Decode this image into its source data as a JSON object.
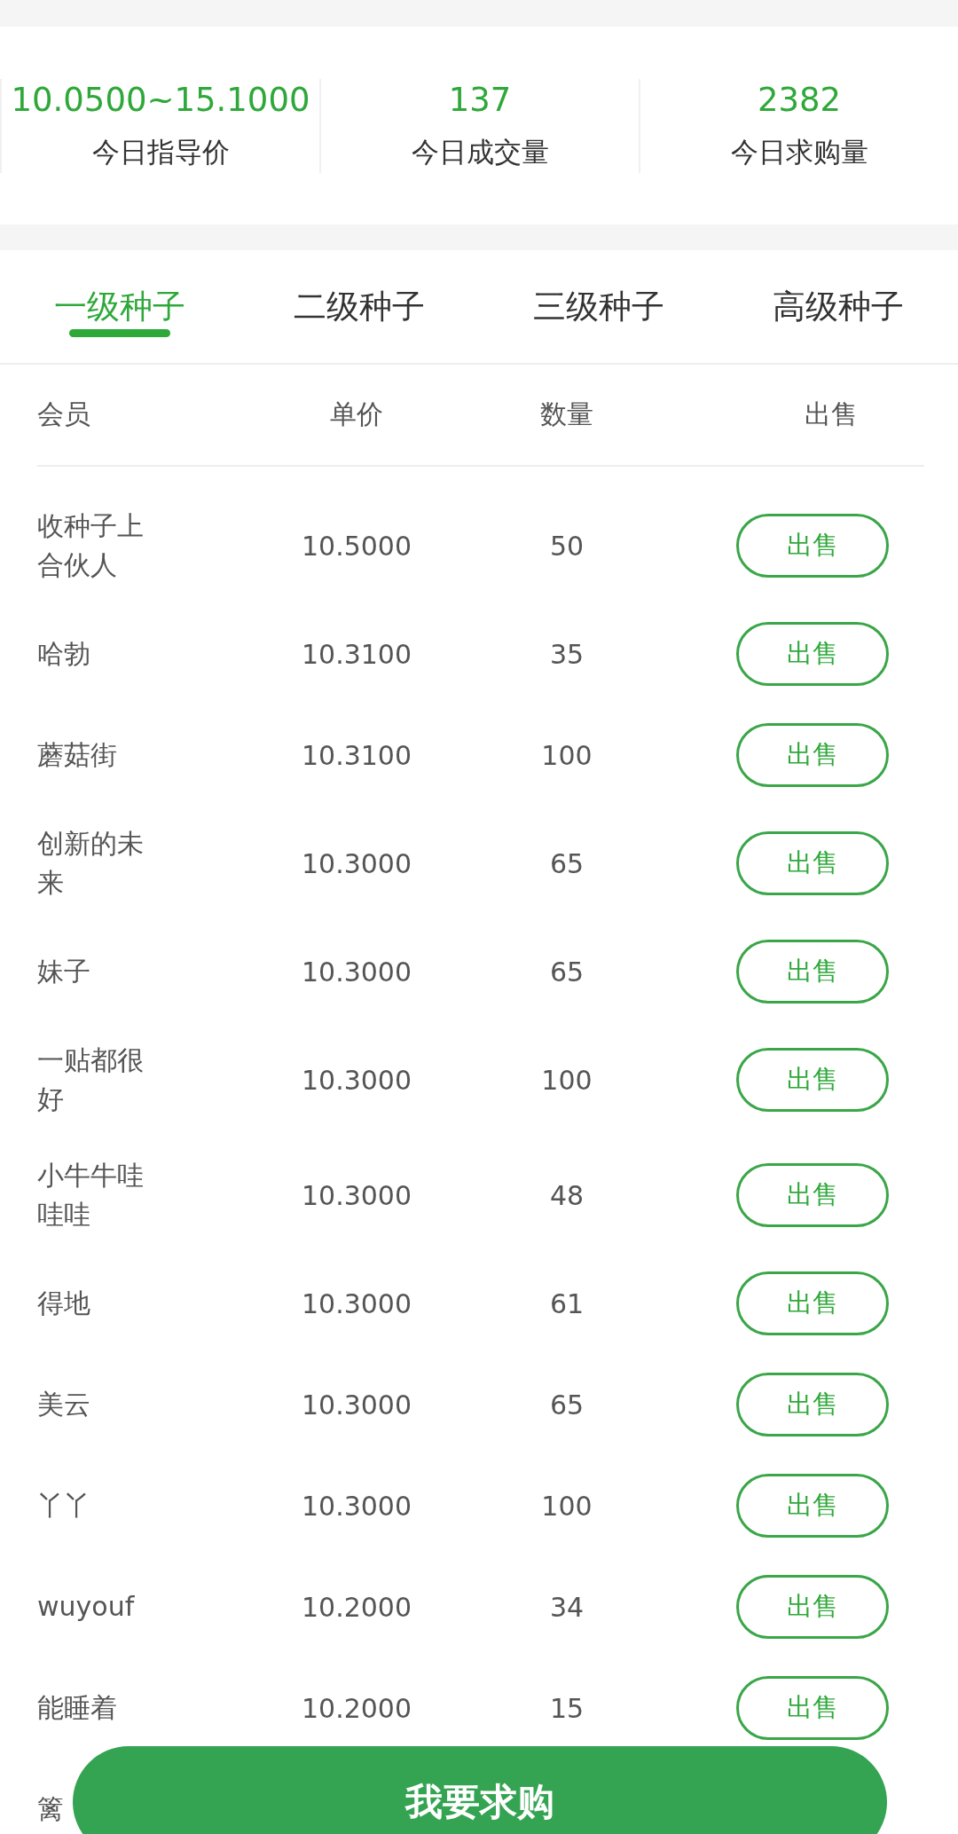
{
  "stats": [
    {
      "value": "10.0500~15.1000",
      "label": "今日指导价"
    },
    {
      "value": "137",
      "label": "今日成交量"
    },
    {
      "value": "2382",
      "label": "今日求购量"
    }
  ],
  "tabs": [
    {
      "label": "一级种子",
      "selected": true
    },
    {
      "label": "二级种子",
      "selected": false
    },
    {
      "label": "三级种子",
      "selected": false
    },
    {
      "label": "高级种子",
      "selected": false
    }
  ],
  "table": {
    "columns": [
      "会员",
      "单价",
      "数量",
      "出售"
    ],
    "rows": [
      {
        "member": "收种子上合伙人",
        "price": "10.5000",
        "quantity": "50",
        "action": "出售"
      },
      {
        "member": "哈勃",
        "price": "10.3100",
        "quantity": "35",
        "action": "出售"
      },
      {
        "member": "蘑菇街",
        "price": "10.3100",
        "quantity": "100",
        "action": "出售"
      },
      {
        "member": "创新的未来",
        "price": "10.3000",
        "quantity": "65",
        "action": "出售"
      },
      {
        "member": "妹子",
        "price": "10.3000",
        "quantity": "65",
        "action": "出售"
      },
      {
        "member": "一贴都很好",
        "price": "10.3000",
        "quantity": "100",
        "action": "出售"
      },
      {
        "member": "小牛牛哇哇哇",
        "price": "10.3000",
        "quantity": "48",
        "action": "出售"
      },
      {
        "member": "得地",
        "price": "10.3000",
        "quantity": "61",
        "action": "出售"
      },
      {
        "member": "美云",
        "price": "10.3000",
        "quantity": "65",
        "action": "出售"
      },
      {
        "member": "丫丫",
        "price": "10.3000",
        "quantity": "100",
        "action": "出售"
      },
      {
        "member": "wuyouf",
        "price": "10.2000",
        "quantity": "34",
        "action": "出售"
      },
      {
        "member": "能睡着",
        "price": "10.2000",
        "quantity": "15",
        "action": "出售"
      },
      {
        "member": "篱"
      }
    ]
  },
  "buy_button": "我要求购"
}
